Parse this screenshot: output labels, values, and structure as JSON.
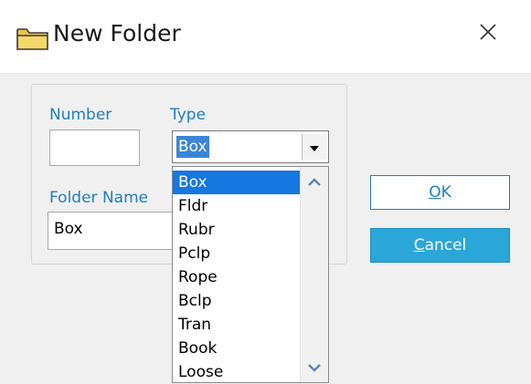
{
  "window": {
    "title": "New Folder",
    "icon": "folder-icon",
    "close_icon": "close-icon"
  },
  "form": {
    "number_label": "Number",
    "number_value": "",
    "type_label": "Type",
    "type_selected": "Box",
    "folder_name_label": "Folder Name",
    "folder_name_value": "Box"
  },
  "dropdown": {
    "options": [
      "Box",
      "Fldr",
      "Rubr",
      "Pclp",
      "Rope",
      "Bclp",
      "Tran",
      "Book",
      "Loose"
    ],
    "highlighted": "Box"
  },
  "buttons": {
    "ok_mnemonic": "O",
    "ok_rest": "K",
    "cancel_mnemonic": "C",
    "cancel_rest": "ancel"
  },
  "colors": {
    "accent": "#1f7ec2",
    "selection": "#1577e0",
    "cancel_bg": "#2aa6d9"
  }
}
